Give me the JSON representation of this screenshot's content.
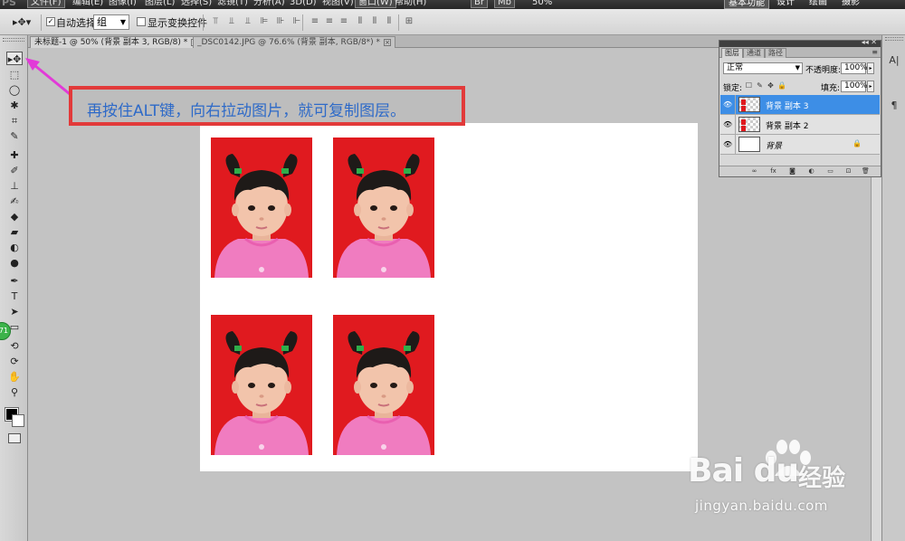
{
  "menubar": {
    "items": [
      "文件(F)",
      "编辑(E)",
      "图像(I)",
      "图层(L)",
      "选择(S)",
      "滤镜(T)",
      "分析(A)",
      "3D(D)",
      "视图(V)",
      "窗口(W)",
      "帮助(H)"
    ],
    "zoom_label": "50%",
    "workspace_buttons": [
      "基本功能",
      "设计",
      "绘画",
      "摄影"
    ]
  },
  "options": {
    "auto_select_label": "自动选择:",
    "auto_select_value": "组",
    "show_transform_label": "显示变换控件"
  },
  "tabs": [
    {
      "label": "未标题-1 @ 50% (背景 副本 3, RGB/8) *"
    },
    {
      "label": "_DSC0142.JPG @ 76.6% (背景 副本, RGB/8*) *"
    }
  ],
  "layers_panel": {
    "tabs": [
      "图层",
      "通道",
      "路径"
    ],
    "blend_mode": "正常",
    "opacity_label": "不透明度:",
    "opacity_value": "100%",
    "lock_label": "锁定:",
    "fill_label": "填充:",
    "fill_value": "100%",
    "layers": [
      {
        "name": "背景 副本 3",
        "selected": true
      },
      {
        "name": "背景 副本 2",
        "selected": false
      },
      {
        "name": "背景",
        "selected": false,
        "locked": true
      }
    ]
  },
  "annotation": {
    "text": "再按住ALT键，向右拉动图片，就可复制图层。"
  },
  "badge": {
    "text": "71"
  },
  "watermark": {
    "logo": "Bai du",
    "cn": "经验",
    "url": "jingyan.baidu.com"
  },
  "colors": {
    "photo_background": "#e01a1f",
    "annotation_border": "#e23a3a",
    "annotation_text": "#2e6ac8",
    "arrow": "#e23ad8",
    "selected_layer": "#3d8ee6"
  }
}
